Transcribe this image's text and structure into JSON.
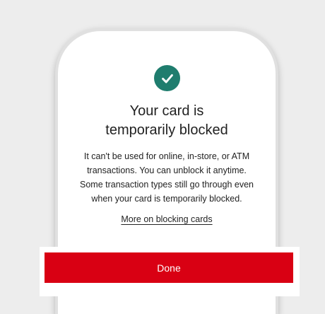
{
  "dialog": {
    "status_icon": "check-circle-icon",
    "title_line1": "Your card is",
    "title_line2": "temporarily blocked",
    "body_line1": "It can't be used for online, in-store, or ATM",
    "body_line2": "transactions. You can unblock it anytime.",
    "body_line3": "Some transaction types still go through even",
    "body_line4": "when your card is temporarily blocked.",
    "link_label": "More on blocking cards",
    "done_label": "Done"
  },
  "colors": {
    "success": "#1f7d6e",
    "primary": "#d90013",
    "background": "#ededed"
  }
}
